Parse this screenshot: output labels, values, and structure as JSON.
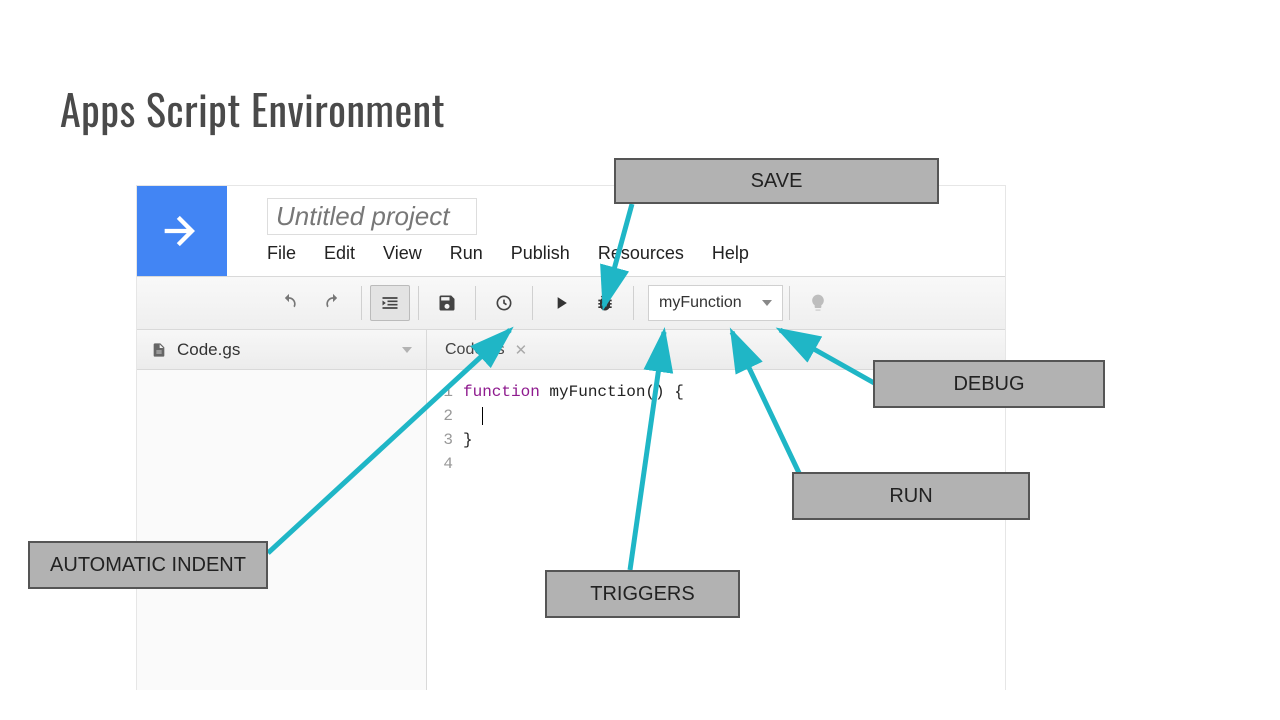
{
  "slide": {
    "title": "Apps Script Environment"
  },
  "project": {
    "title": "Untitled project"
  },
  "menus": [
    "File",
    "Edit",
    "View",
    "Run",
    "Publish",
    "Resources",
    "Help"
  ],
  "toolbar": {
    "function_name": "myFunction"
  },
  "sidebar": {
    "file": "Code.gs"
  },
  "tab": {
    "name": "Code.gs"
  },
  "code": {
    "lines": [
      "1",
      "2",
      "3",
      "4"
    ],
    "keyword": "function",
    "rest_line1": " myFunction() {",
    "line3": "}"
  },
  "labels": {
    "save": "SAVE",
    "indent": "AUTOMATIC INDENT",
    "triggers": "TRIGGERS",
    "run": "RUN",
    "debug": "DEBUG"
  }
}
